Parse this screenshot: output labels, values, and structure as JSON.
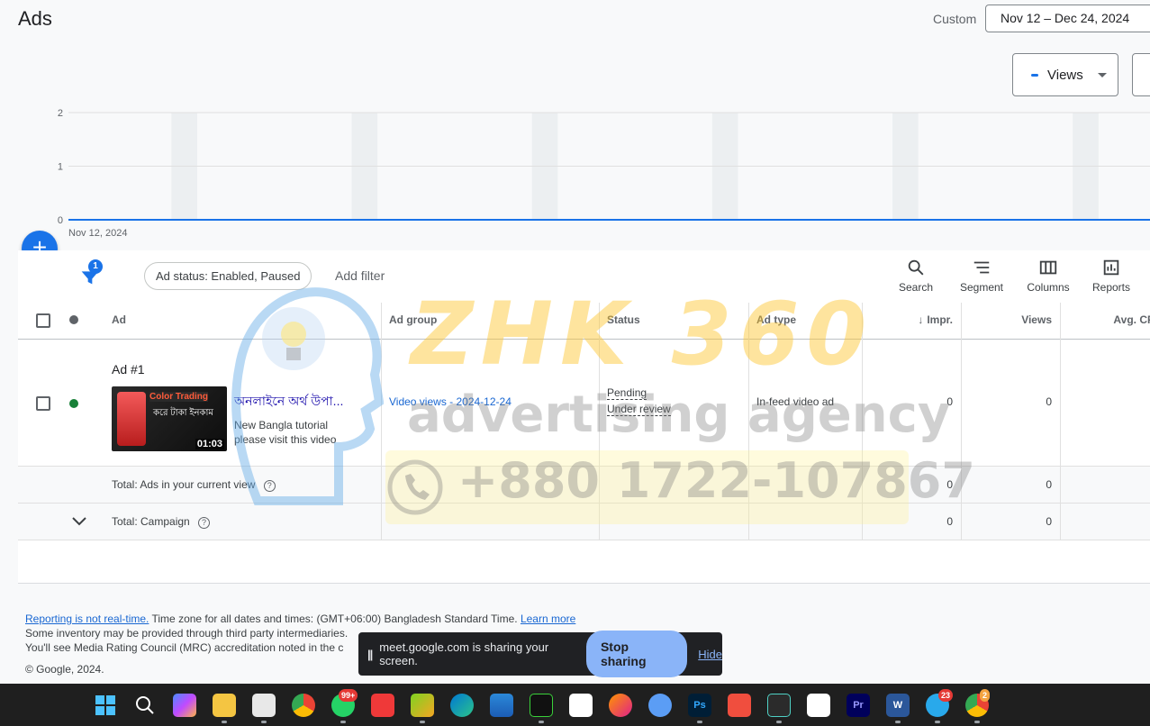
{
  "header": {
    "title": "Ads",
    "date_label": "Custom",
    "date_range": "Nov 12 – Dec 24, 2024"
  },
  "chart_controls": {
    "metric": "Views"
  },
  "chart_data": {
    "type": "line",
    "y_ticks": [
      "2",
      "1",
      "0"
    ],
    "ylim": [
      0,
      2
    ],
    "x_start_label": "Nov 12, 2024",
    "series": [
      {
        "values": [
          0,
          0,
          0,
          0,
          0,
          0,
          0,
          0,
          0,
          0,
          0,
          0,
          0,
          0,
          0,
          0,
          0,
          0,
          0,
          0,
          0,
          0,
          0,
          0,
          0,
          0,
          0,
          0,
          0,
          0,
          0,
          0,
          0,
          0,
          0,
          0,
          0,
          0,
          0,
          0,
          0,
          0,
          0
        ],
        "color": "#1a73e8"
      }
    ],
    "grid": true,
    "weekend_bands": true
  },
  "filters": {
    "count": "1",
    "chip": "Ad status: Enabled, Paused",
    "add_filter": "Add filter"
  },
  "toolbar": {
    "search": "Search",
    "segment": "Segment",
    "columns": "Columns",
    "reports": "Reports"
  },
  "table": {
    "headers": {
      "ad": "Ad",
      "ad_group": "Ad group",
      "status": "Status",
      "ad_type": "Ad type",
      "impr": "Impr.",
      "views": "Views",
      "avg_cpv": "Avg. CPV"
    },
    "rows": [
      {
        "label": "Ad #1",
        "headline": "অনলাইনে অর্থ উপা...",
        "description_1": "New Bangla tutorial",
        "description_2": "please visit this video",
        "thumb_title": "Color Trading",
        "thumb_subtitle": "করে টাকা ইনকাম",
        "thumb_duration": "01:03",
        "ad_group": "Video views - 2024-12-24",
        "status_1": "Pending",
        "status_2": "Under review",
        "ad_type": "In-feed video ad",
        "impr": "0",
        "views": "0",
        "avg_cpv": "–",
        "status_color": "#188038"
      }
    ],
    "total_view": {
      "label": "Total: Ads in your current view",
      "impr": "0",
      "views": "0",
      "avg_cpv": "–"
    },
    "total_campaign": {
      "label": "Total: Campaign",
      "impr": "0",
      "views": "0",
      "avg_cpv": "–"
    }
  },
  "watermark": {
    "brand": "ZHK 360",
    "tagline": "advertising agency",
    "phone": "+880 1722-107867"
  },
  "footer": {
    "realtime_link": "Reporting is not real-time.",
    "timezone": " Time zone for all dates and times: (GMT+06:00) Bangladesh Standard Time. ",
    "learn_more": "Learn more",
    "line2": "Some inventory may be provided through third party intermediaries.",
    "line3": "You'll see Media Rating Council (MRC) accreditation noted in the c",
    "copyright": "© Google, 2024."
  },
  "share_bar": {
    "pause_icon": "||",
    "message": "meet.google.com is sharing your screen.",
    "stop": "Stop sharing",
    "hide": "Hide"
  },
  "taskbar": {
    "whatsapp_badge": "99+",
    "telegram_badge": "23",
    "chrome_badge": "2"
  }
}
